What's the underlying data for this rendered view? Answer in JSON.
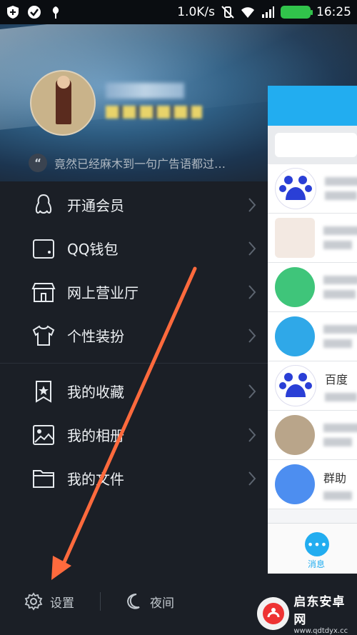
{
  "status_bar": {
    "speed": "1.0K/s",
    "time": "16:25"
  },
  "profile": {
    "signature": "竟然已经麻木到一句广告语都过…"
  },
  "menu": {
    "items": [
      {
        "label": "开通会员",
        "icon": "penguin-icon"
      },
      {
        "label": "QQ钱包",
        "icon": "wallet-icon"
      },
      {
        "label": "网上营业厅",
        "icon": "store-icon"
      },
      {
        "label": "个性装扮",
        "icon": "tshirt-icon"
      },
      {
        "label": "我的收藏",
        "icon": "bookmark-star-icon"
      },
      {
        "label": "我的相册",
        "icon": "photo-icon"
      },
      {
        "label": "我的文件",
        "icon": "folder-icon"
      }
    ]
  },
  "footer": {
    "settings_label": "设置",
    "night_label": "夜间"
  },
  "chat_panel": {
    "visible_titles": [
      "百度",
      "群助"
    ],
    "tab_label": "消息"
  },
  "watermark": {
    "title": "启东安卓网",
    "url": "www.qdtdyx.cc"
  },
  "colors": {
    "accent": "#22adf0",
    "arrow": "#ff6a3d",
    "drawer_bg": "#1b1f26"
  }
}
